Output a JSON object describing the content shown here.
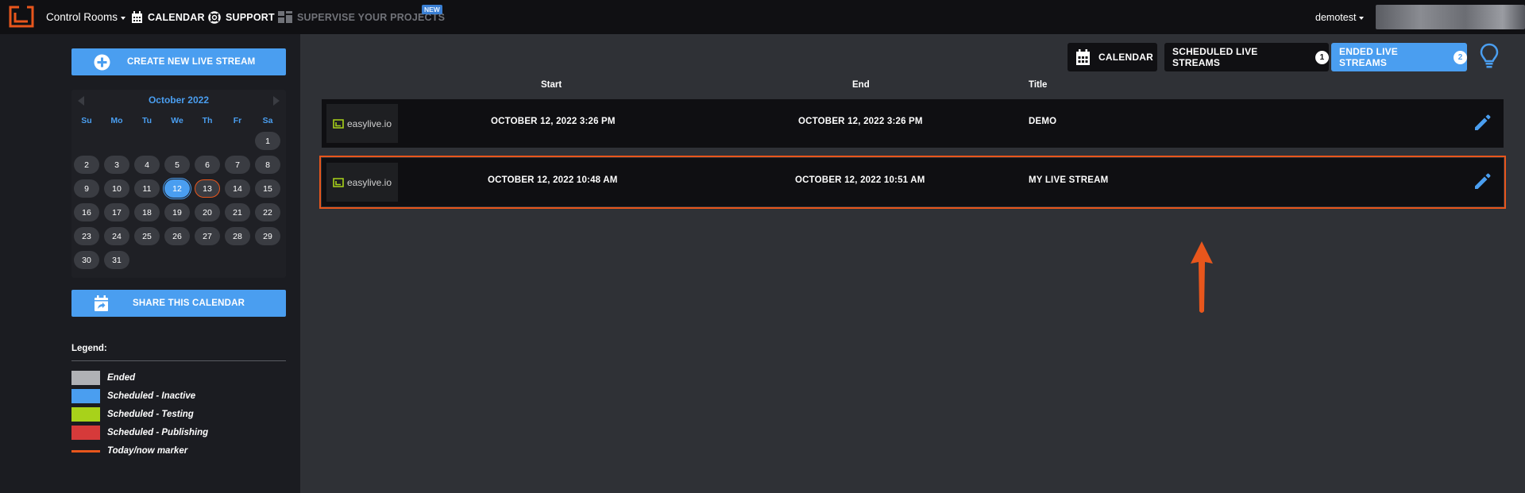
{
  "nav": {
    "control_rooms": "Control Rooms",
    "calendar": "CALENDAR",
    "support": "SUPPORT",
    "supervise": "SUPERVISE YOUR PROJECTS",
    "new_badge": "NEW",
    "user": "demotest"
  },
  "sidebar": {
    "create_button": "CREATE NEW LIVE STREAM",
    "share_button": "SHARE THIS CALENDAR",
    "calendar": {
      "month": "October 2022",
      "weekdays": [
        "Su",
        "Mo",
        "Tu",
        "We",
        "Th",
        "Fr",
        "Sa"
      ],
      "selected_day": "12",
      "today_day": "13"
    },
    "legend": {
      "title": "Legend:",
      "items": [
        {
          "label": "Ended",
          "color": "#b0b1b5"
        },
        {
          "label": "Scheduled - Inactive",
          "color": "#4a9ef0"
        },
        {
          "label": "Scheduled - Testing",
          "color": "#a8d21a"
        },
        {
          "label": "Scheduled - Publishing",
          "color": "#d63a3a"
        },
        {
          "label": "Today/now marker",
          "color": "#e8561c"
        }
      ]
    }
  },
  "toolbar": {
    "calendar": "CALENDAR",
    "scheduled": "SCHEDULED LIVE STREAMS",
    "scheduled_count": "1",
    "ended": "ENDED LIVE STREAMS",
    "ended_count": "2"
  },
  "table": {
    "headers": {
      "start": "Start",
      "end": "End",
      "title": "Title"
    },
    "rows": [
      {
        "thumb": "easylive.io",
        "start": "OCTOBER 12, 2022 3:26 PM",
        "end": "OCTOBER 12, 2022 3:26 PM",
        "title": "DEMO"
      },
      {
        "thumb": "easylive.io",
        "start": "OCTOBER 12, 2022 10:48 AM",
        "end": "OCTOBER 12, 2022 10:51 AM",
        "title": "MY LIVE STREAM"
      }
    ]
  },
  "colors": {
    "accent": "#4a9ef0",
    "highlight": "#e8561c",
    "brand": "#e8561c"
  }
}
